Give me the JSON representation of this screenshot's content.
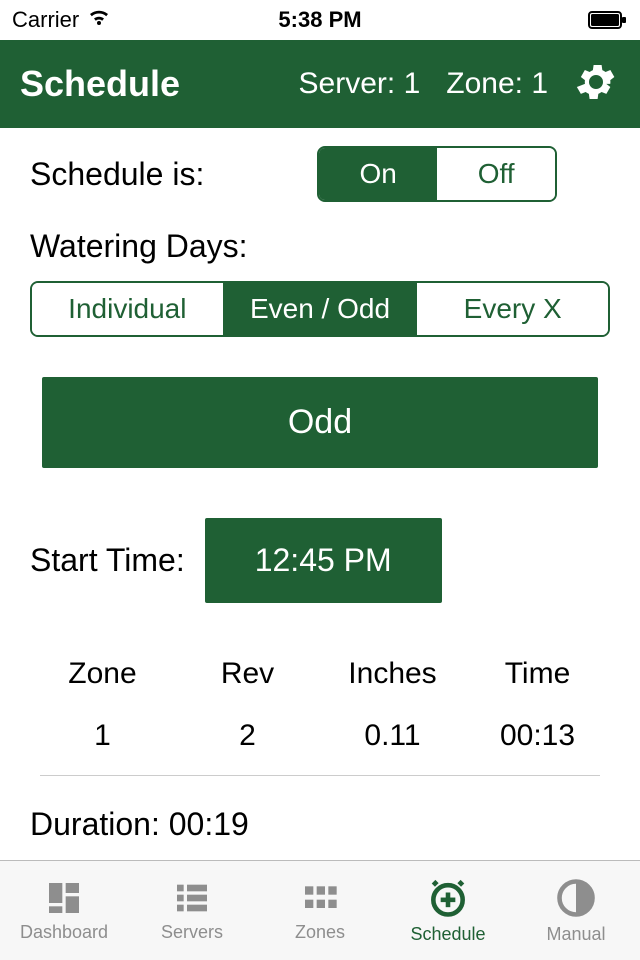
{
  "status": {
    "carrier": "Carrier",
    "time": "5:38 PM"
  },
  "header": {
    "title": "Schedule",
    "server": "Server: 1",
    "zone": "Zone: 1"
  },
  "schedule_is": {
    "label": "Schedule is:",
    "on": "On",
    "off": "Off"
  },
  "watering_days": {
    "label": "Watering Days:",
    "opts": [
      "Individual",
      "Even / Odd",
      "Every X"
    ]
  },
  "odd_button": "Odd",
  "start_time": {
    "label": "Start Time:",
    "value": "12:45 PM"
  },
  "table": {
    "headers": [
      "Zone",
      "Rev",
      "Inches",
      "Time"
    ],
    "row": [
      "1",
      "2",
      "0.11",
      "00:13"
    ]
  },
  "duration": "Duration: 00:19",
  "tabs": [
    "Dashboard",
    "Servers",
    "Zones",
    "Schedule",
    "Manual"
  ]
}
